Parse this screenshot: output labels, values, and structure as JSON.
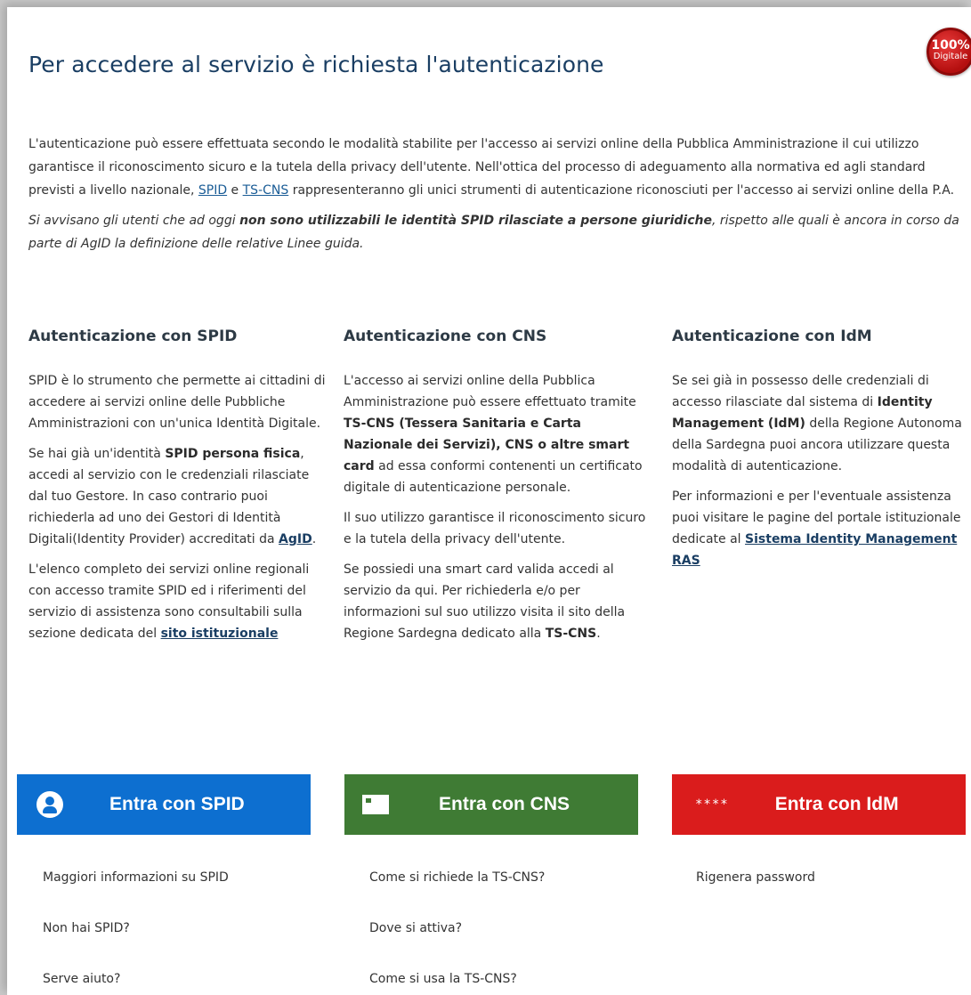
{
  "header": {
    "title": "Per accedere al servizio è richiesta l'autenticazione",
    "badge_pct": "100%",
    "badge_label": "Digitale"
  },
  "intro": {
    "p1_a": "L'autenticazione può essere effettuata secondo le modalità stabilite per l'accesso ai servizi online della Pubblica Amministrazione il cui utilizzo garantisce il riconoscimento sicuro e la tutela della privacy dell'utente. Nell'ottica del processo di adeguamento alla normativa ed agli standard previsti a livello nazionale, ",
    "spid_link": "SPID",
    "and": " e ",
    "tscns_link": "TS-CNS",
    "p1_b": " rappresenteranno gli unici strumenti di autenticazione riconosciuti per l'accesso ai servizi online della P.A.",
    "p2_a": "Si avvisano gli utenti che ad oggi ",
    "p2_bold": "non sono utilizzabili le identità SPID rilasciate a persone giuridiche",
    "p2_b": ", rispetto alle quali è ancora in corso da parte di AgID la definizione delle relative Linee guida."
  },
  "spid": {
    "heading": "Autenticazione con SPID",
    "p1": "SPID è lo strumento che permette ai cittadini di accedere ai servizi online delle Pubbliche Amministrazioni con un'unica Identità Digitale.",
    "p2_a": "Se hai già un'identità ",
    "p2_bold": "SPID persona fisica",
    "p2_b": ", accedi al servizio con le credenziali rilasciate dal tuo Gestore. In caso contrario puoi richiederla ad uno dei Gestori di Identità Digitali(Identity Provider) accreditati da ",
    "agid_link": "AgID",
    "p2_c": ".",
    "p3_a": "L'elenco completo dei servizi online regionali con accesso tramite SPID ed i riferimenti del servizio di assistenza sono consultabili sulla sezione dedicata del ",
    "sito_link": "sito istituzionale",
    "button": "Entra con SPID",
    "links": [
      "Maggiori informazioni su SPID",
      "Non hai SPID?",
      "Serve aiuto?"
    ]
  },
  "cns": {
    "heading": "Autenticazione con CNS",
    "p1_a": "L'accesso ai servizi online della Pubblica Amministrazione può essere effettuato tramite ",
    "p1_bold1": "TS-CNS (Tessera Sanitaria e Carta Nazionale dei Servizi), CNS o altre smart card",
    "p1_b": " ad essa conformi contenenti un certificato digitale di autenticazione personale.",
    "p2": "Il suo utilizzo garantisce il riconoscimento sicuro e la tutela della privacy dell'utente.",
    "p3_a": "Se possiedi una smart card valida accedi al servizio da qui. Per richiederla e/o per informazioni sul suo utilizzo visita il sito della Regione Sardegna dedicato alla ",
    "p3_bold": "TS-CNS",
    "p3_b": ".",
    "button": "Entra con CNS",
    "links": [
      "Come si richiede la TS-CNS?",
      "Dove si attiva?",
      "Come si usa la TS-CNS?"
    ]
  },
  "idm": {
    "heading": "Autenticazione con IdM",
    "p1_a": "Se sei già in possesso delle credenziali di accesso rilasciate dal sistema di ",
    "p1_bold": "Identity Management (IdM)",
    "p1_b": " della Regione Autonoma della Sardegna puoi ancora utilizzare questa modalità di autenticazione.",
    "p2_a": "Per informazioni e per l'eventuale assistenza puoi visitare le pagine del portale istituzionale dedicate al ",
    "sistema_link": "Sistema Identity Management RAS",
    "stars": "****",
    "button": "Entra con IdM",
    "links": [
      "Rigenera password"
    ]
  },
  "colors": {
    "spid_blue": "#0d6fd0",
    "cns_green": "#3f7b34",
    "idm_red": "#da1c1c",
    "title_blue": "#1a3e63"
  }
}
